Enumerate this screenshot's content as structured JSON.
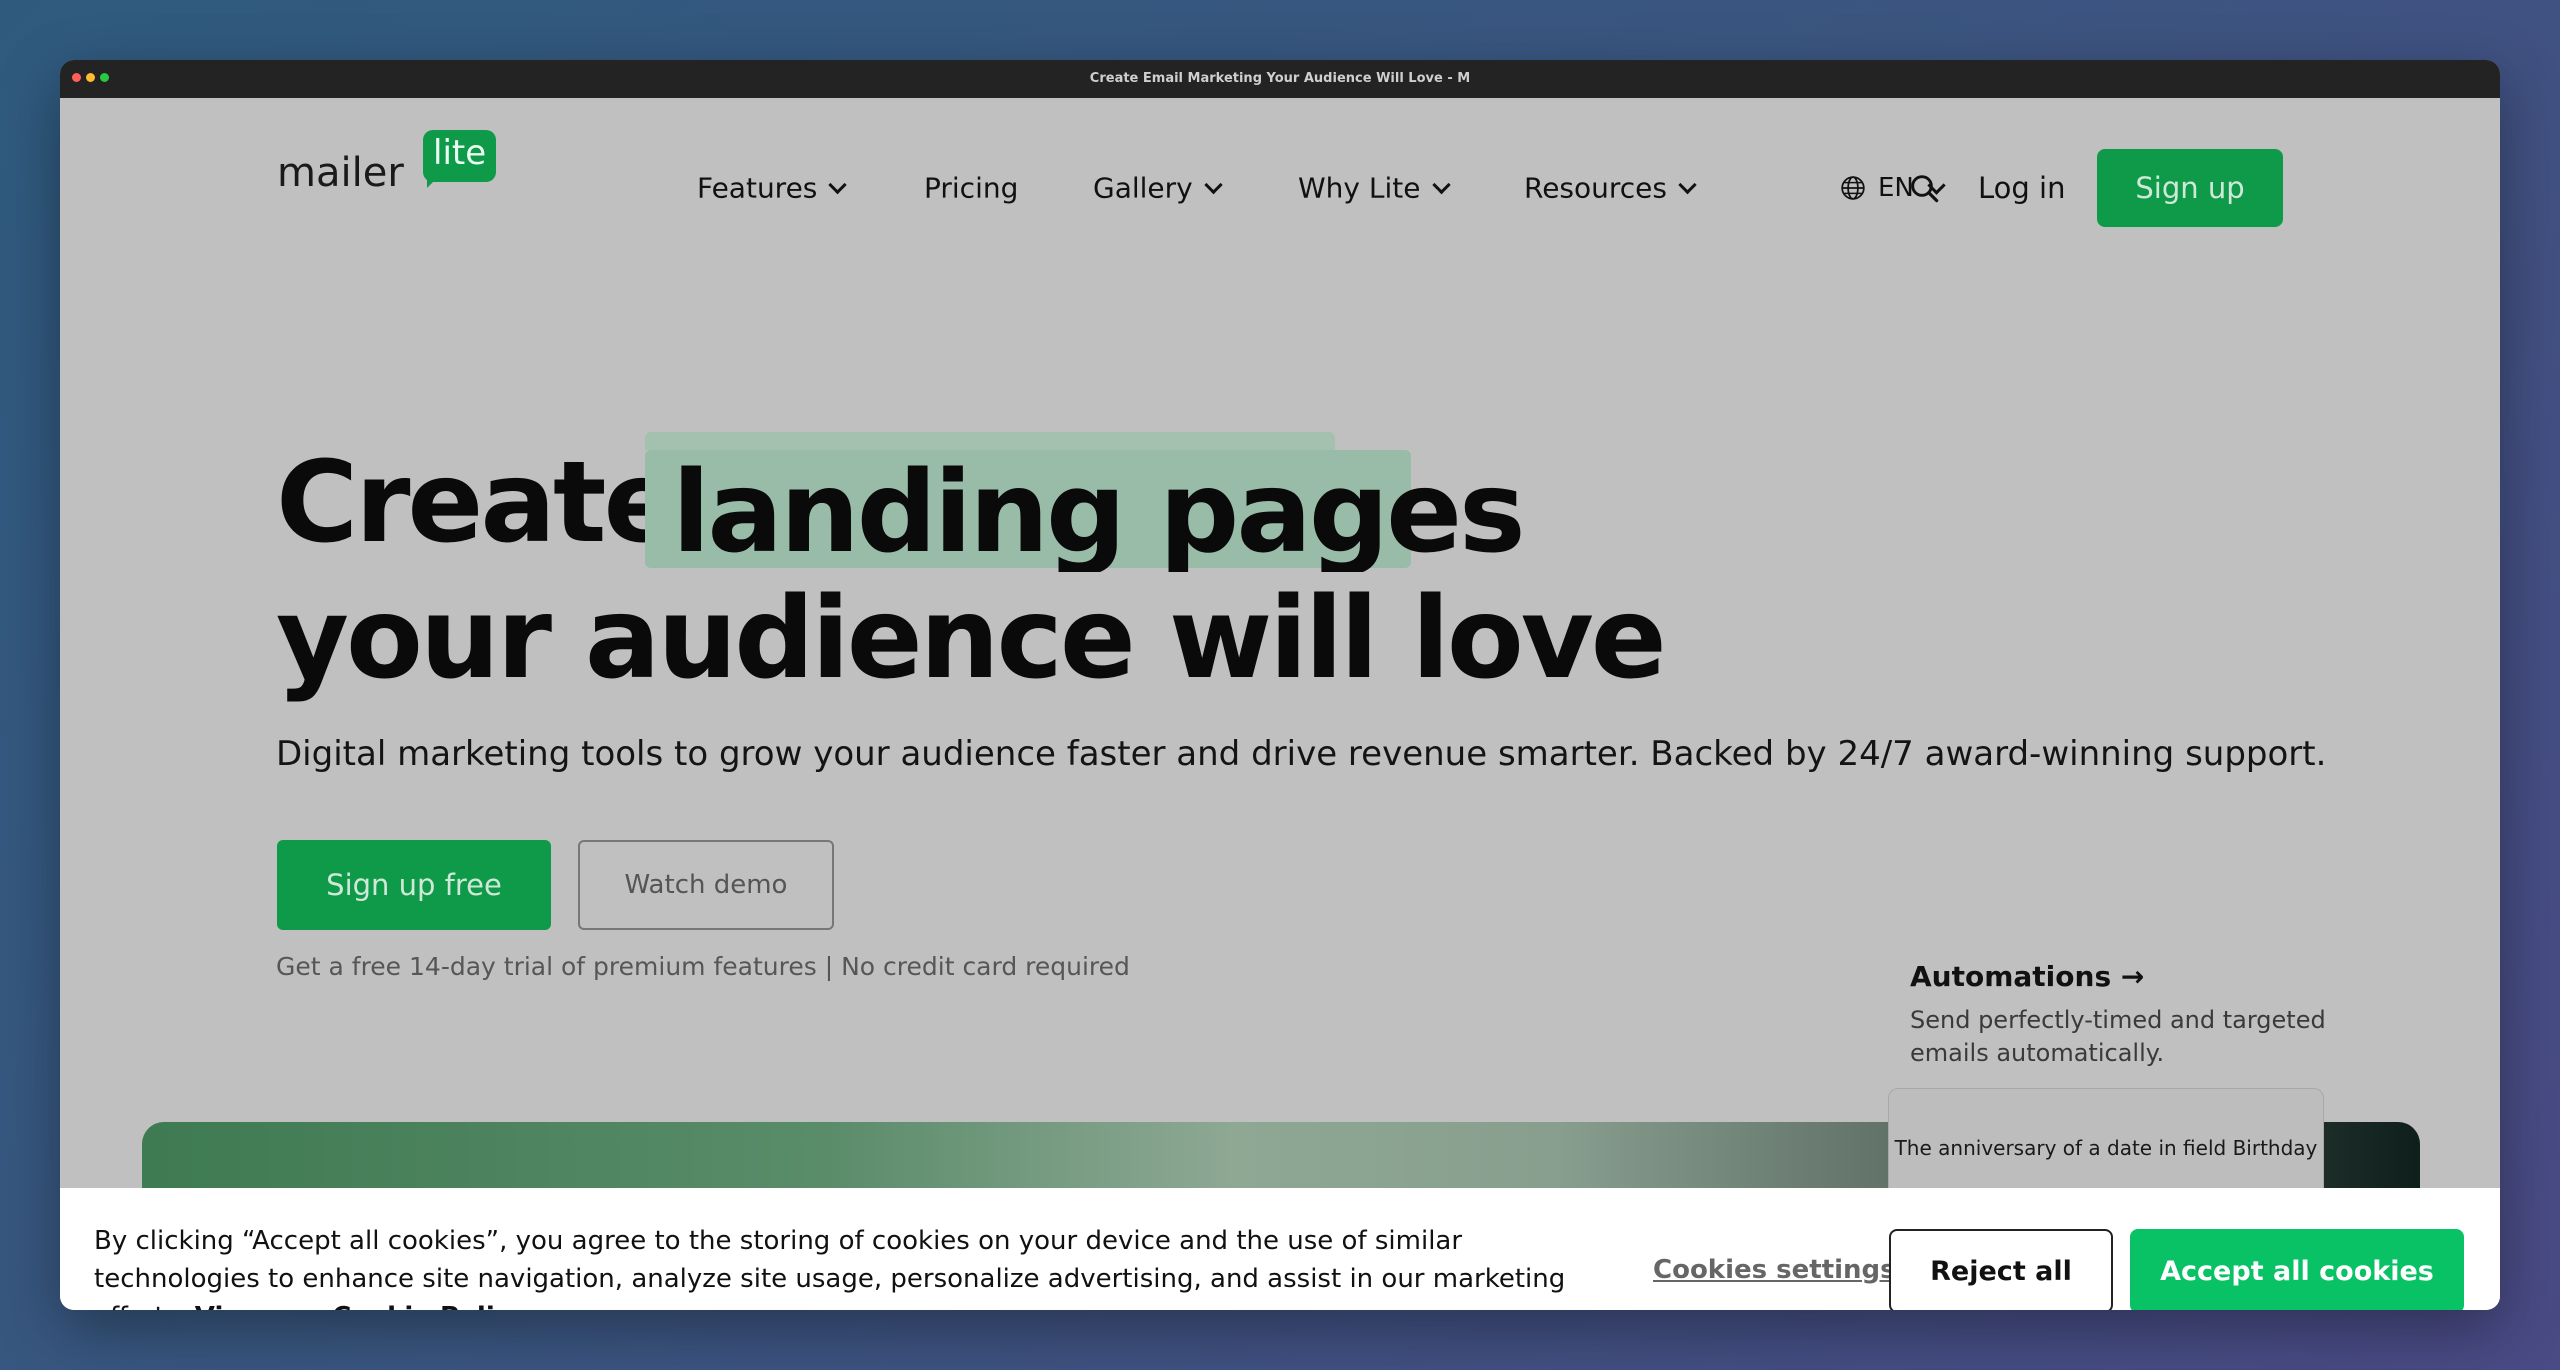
{
  "window": {
    "title": "Create Email Marketing Your Audience Will Love - M"
  },
  "logo": {
    "word": "mailer",
    "badge": "lite"
  },
  "nav": {
    "items": [
      {
        "label": "Features",
        "dropdown": true
      },
      {
        "label": "Pricing",
        "dropdown": false
      },
      {
        "label": "Gallery",
        "dropdown": true
      },
      {
        "label": "Why Lite",
        "dropdown": true
      },
      {
        "label": "Resources",
        "dropdown": true
      }
    ],
    "language": "EN",
    "login": "Log in",
    "signup": "Sign up"
  },
  "hero": {
    "line1_prefix": "Create",
    "highlight": "landing pages",
    "line2": "your audience will love",
    "subtitle": "Digital marketing tools to grow your audience faster and drive revenue smarter. Backed by 24/7 award-winning support.",
    "cta_primary": "Sign up free",
    "cta_secondary": "Watch demo",
    "trial_note": "Get a free 14-day trial of premium features | No credit card required"
  },
  "feature_card": {
    "title": "Automations →",
    "description": "Send perfectly-timed and targeted emails automatically.",
    "preview_text": "The anniversary of a date in field Birthday"
  },
  "cookie": {
    "text": "By clicking “Accept all cookies”, you agree to the storing of cookies on your device and the use of similar technologies to enhance site navigation, analyze site usage, personalize advertising, and assist in our marketing efforts. ",
    "link": "View our Cookie Policy",
    "suffix": ".",
    "settings": "Cookies settings",
    "reject": "Reject all",
    "accept": "Accept all cookies"
  },
  "colors": {
    "brand_green": "#0f9a4a",
    "accept_green": "#09c266"
  }
}
